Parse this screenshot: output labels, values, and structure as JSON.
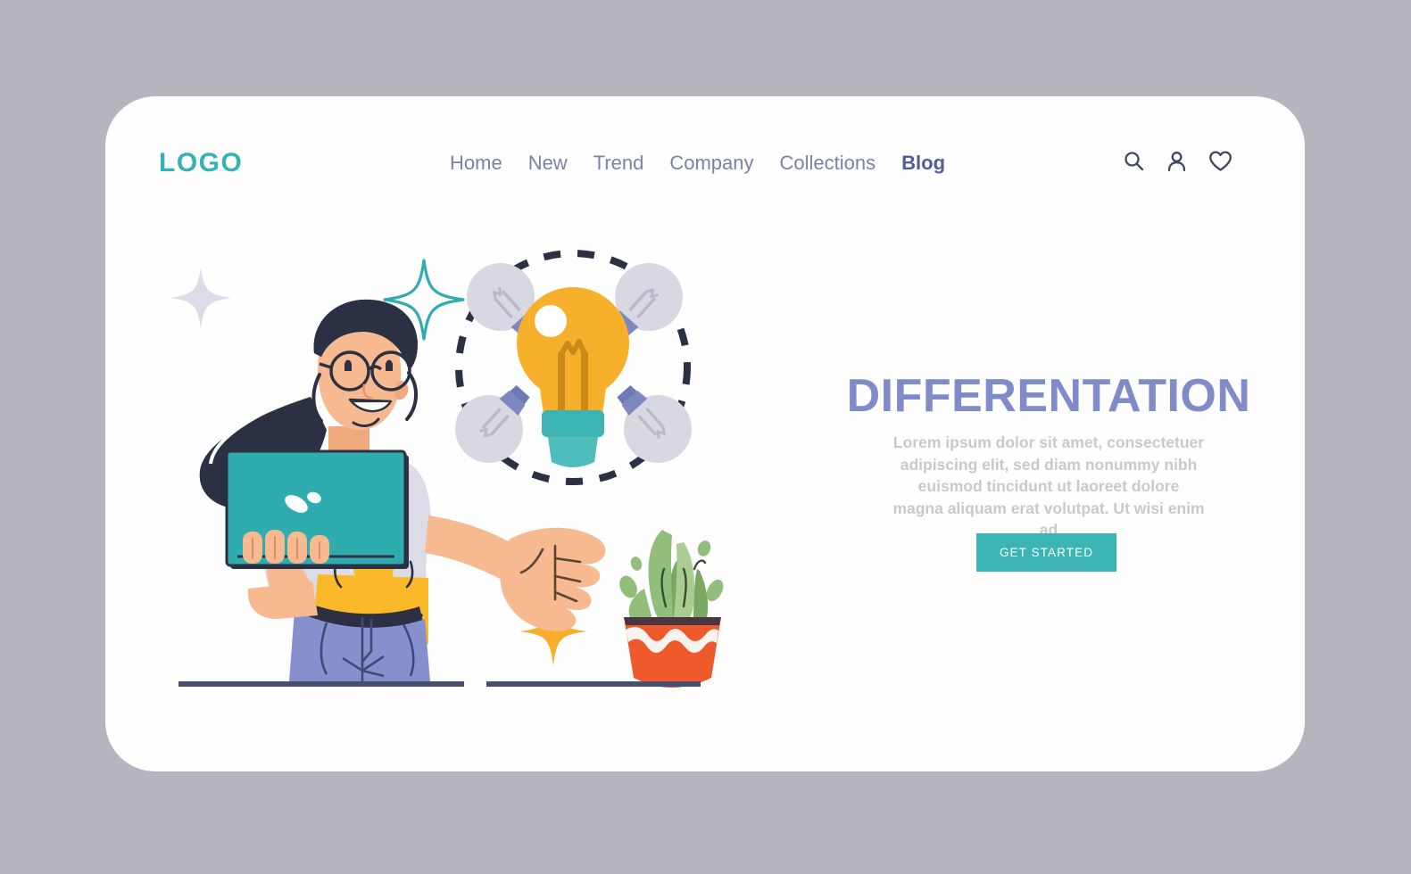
{
  "page": {
    "background_color": "#b6b5bd",
    "card_color": "#fefefe"
  },
  "header": {
    "logo_text": "LOGO",
    "logo_color": "#34b3b0",
    "nav_items": [
      {
        "label": "Home",
        "active": false
      },
      {
        "label": "New",
        "active": false
      },
      {
        "label": "Trend",
        "active": false
      },
      {
        "label": "Company",
        "active": false
      },
      {
        "label": "Collections",
        "active": false
      },
      {
        "label": "Blog",
        "active": true
      }
    ],
    "nav_color": "#7c81a8",
    "nav_active_color": "#535d91",
    "icons": [
      {
        "name": "search-icon",
        "label": "Search"
      },
      {
        "name": "user-icon",
        "label": "Account"
      },
      {
        "name": "heart-icon",
        "label": "Favorites"
      }
    ],
    "icon_color": "#3f4761"
  },
  "hero": {
    "title": "DIFFERENTATION",
    "title_color": "#7f8cc9",
    "body": "Lorem ipsum dolor sit amet, consectetuer adipiscing elit, sed diam nonummy nibh euismod tincidunt ut laoreet dolore magna aliquam erat volutpat. Ut wisi enim ad",
    "body_color": "#c8c8cd",
    "cta_label": "GET STARTED",
    "cta_color": "#3cb4b4",
    "cta_text_color": "#ffffff"
  },
  "illustration": {
    "description": "Smiling woman with dark ponytail and round glasses holding a teal laptop, gesturing toward a glowing yellow lightbulb surrounded by four grey unlit bulbs inside a dashed circle, with a potted succulent and decorative sparkle stars",
    "colors": {
      "skin": "#f7b98f",
      "hair": "#2b3042",
      "shirt": "#dcdce8",
      "overalls": "#f9b928",
      "jeans": "#8590cc",
      "laptop": "#2fadae",
      "bulb_on": "#f7b02c",
      "bulb_on_base": "#3cb4b4",
      "bulb_off": "#d8d8e2",
      "bulb_off_base": "#7d87c0",
      "plant_leaf": "#93bd7b",
      "plant_leaf_dark": "#7aa862",
      "plant_pot": "#ef5a2c",
      "ground_line": "#474f6e",
      "star_grey": "#dcdce8",
      "star_teal": "#2fadae",
      "star_yellow": "#f9ae29"
    }
  }
}
